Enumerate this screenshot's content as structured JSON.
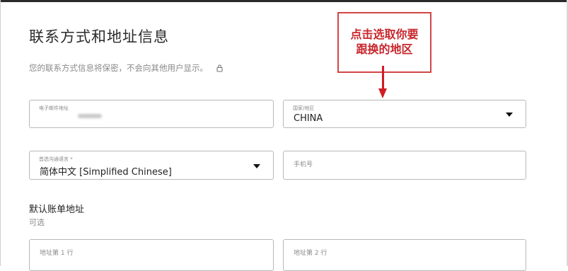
{
  "page": {
    "title": "联系方式和地址信息",
    "subtitle": "您的联系方式信息将保密，不会向其他用户显示。",
    "lock_icon": "lock-icon"
  },
  "form": {
    "email": {
      "label": "电子邮件地址",
      "value": ""
    },
    "country": {
      "label": "国家/地区",
      "value": "CHINA"
    },
    "language": {
      "label": "首选沟通语言 *",
      "value": "简体中文 [Simplified Chinese]"
    },
    "phone": {
      "placeholder": "手机号"
    }
  },
  "billing": {
    "title": "默认账单地址",
    "subtitle": "可选",
    "address1_placeholder": "地址第 1 行",
    "address2_placeholder": "地址第 2 行"
  },
  "annotation": {
    "text_line1": "点击选取你要",
    "text_line2": "跟换的地区",
    "color": "#d11c24"
  }
}
